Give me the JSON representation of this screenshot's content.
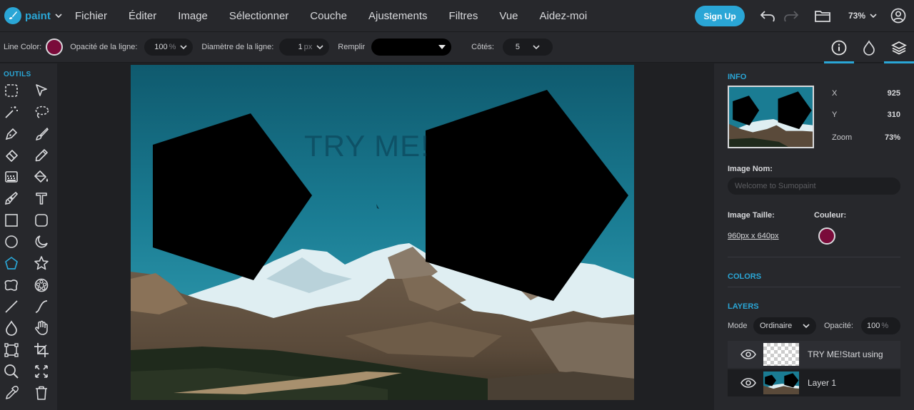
{
  "app": {
    "logo_text": "paint"
  },
  "menu": [
    "Fichier",
    "Éditer",
    "Image",
    "Sélectionner",
    "Couche",
    "Ajustements",
    "Filtres",
    "Vue",
    "Aidez-moi"
  ],
  "topbar": {
    "signup_label": "Sign Up",
    "zoom": "73%"
  },
  "options": {
    "line_color_label": "Line Color:",
    "line_color": "#7a0b3a",
    "opacity_label": "Opacité de la ligne:",
    "opacity_value": "100",
    "opacity_unit": "%",
    "diameter_label": "Diamètre de la ligne:",
    "diameter_value": "1",
    "diameter_unit": "px",
    "fill_label": "Remplir",
    "fill_color": "#000000",
    "sides_label": "Côtés:",
    "sides_value": "5"
  },
  "tools": {
    "title": "OUTILS",
    "items": [
      "marquee-select-icon",
      "pointer-arrow-icon",
      "magic-wand-icon",
      "lasso-icon",
      "pen-icon",
      "brush-icon",
      "eraser-icon",
      "pencil-icon",
      "gradient-icon",
      "fill-bucket-icon",
      "clone-stamp-icon",
      "text-icon",
      "rectangle-icon",
      "rounded-rectangle-icon",
      "circle-icon",
      "crescent-icon",
      "pentagon-icon",
      "star-icon",
      "blob-shape-icon",
      "gear-shape-icon",
      "line-icon",
      "curve-icon",
      "drop-icon",
      "hand-icon",
      "transform-icon",
      "crop-icon",
      "zoom-icon",
      "fit-screen-icon",
      "eyedropper-icon",
      "trash-icon"
    ],
    "active": "pentagon-icon"
  },
  "canvas": {
    "overlay_text": "TRY ME!"
  },
  "panel": {
    "info_title": "INFO",
    "x_label": "X",
    "x_value": "925",
    "y_label": "Y",
    "y_value": "310",
    "zoom_label": "Zoom",
    "zoom_value": "73%",
    "image_name_label": "Image Nom:",
    "image_name_placeholder": "Welcome to Sumopaint",
    "image_size_label": "Image Taille:",
    "image_size_value": "960px x 640px",
    "color_label": "Couleur:",
    "color_value": "#7a0b3a",
    "colors_title": "COLORS",
    "layers_title": "LAYERS",
    "mode_label": "Mode",
    "mode_value": "Ordinaire",
    "opacity_label": "Opacité:",
    "opacity_value": "100",
    "opacity_unit": "%",
    "layers": [
      {
        "name": "TRY ME!Start using"
      },
      {
        "name": "Layer 1"
      }
    ]
  }
}
